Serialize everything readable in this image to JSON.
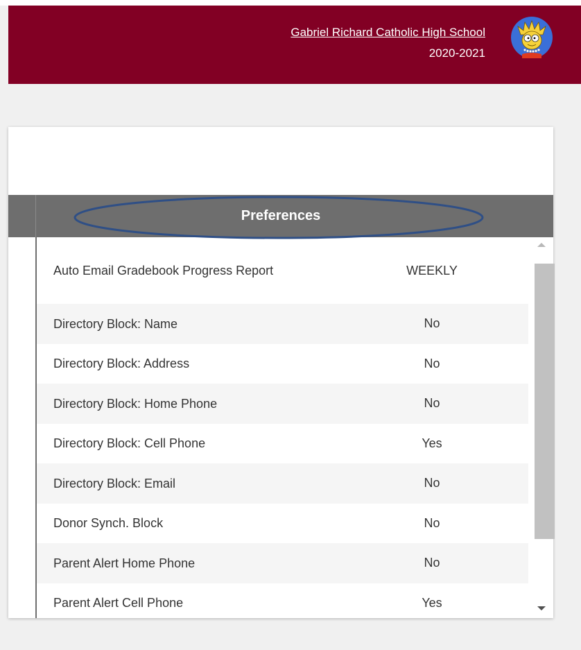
{
  "header": {
    "school_name": "Gabriel Richard Catholic High School",
    "school_year": "2020-2021",
    "background_color": "#820024",
    "avatar_icon": "lisa-simpson-avatar"
  },
  "preferences": {
    "title": "Preferences",
    "rows": [
      {
        "name": "Auto Email Gradebook Progress Report",
        "value": "WEEKLY"
      },
      {
        "name": "Directory Block: Name",
        "value": "No"
      },
      {
        "name": "Directory Block: Address",
        "value": "No"
      },
      {
        "name": "Directory Block: Home Phone",
        "value": "No"
      },
      {
        "name": "Directory Block: Cell Phone",
        "value": "Yes"
      },
      {
        "name": "Directory Block: Email",
        "value": "No"
      },
      {
        "name": "Donor Synch. Block",
        "value": "No"
      },
      {
        "name": "Parent Alert Home Phone",
        "value": "No"
      },
      {
        "name": "Parent Alert Cell Phone",
        "value": "Yes"
      }
    ]
  }
}
